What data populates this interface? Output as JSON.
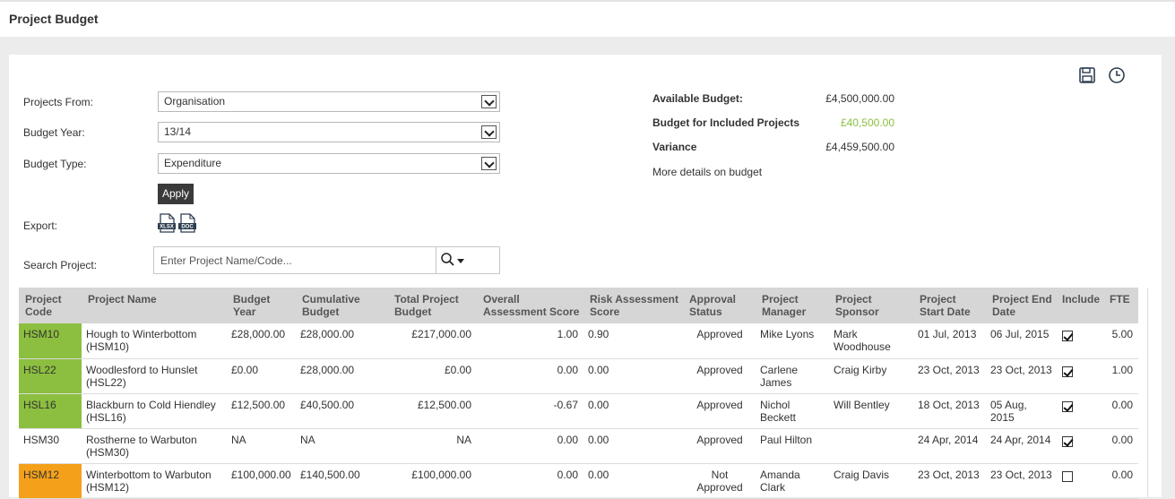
{
  "page": {
    "title": "Project Budget"
  },
  "filters": {
    "projects_from": {
      "label": "Projects From:",
      "value": "Organisation"
    },
    "budget_year": {
      "label": "Budget Year:",
      "value": "13/14"
    },
    "budget_type": {
      "label": "Budget Type:",
      "value": "Expenditure"
    },
    "apply_label": "Apply",
    "export_label": "Export:",
    "export_xlsx": "XLSX",
    "export_doc": "DOC",
    "search_label": "Search Project:",
    "search_placeholder": "Enter Project Name/Code..."
  },
  "budget_summary": {
    "available_label": "Available Budget:",
    "available_value": "£4,500,000.00",
    "included_label": "Budget for Included Projects",
    "included_value": "£40,500.00",
    "variance_label": "Variance",
    "variance_value": "£4,459,500.00",
    "more_link": "More details on budget"
  },
  "colors": {
    "green": "#8cbf3f",
    "orange": "#f5a01a",
    "header_bg": "#d6d6d6"
  },
  "table": {
    "columns": [
      "Project Code",
      "Project Name",
      "Budget Year",
      "Cumulative Budget",
      "Total Project Budget",
      "Overall Assessment Score",
      "Risk Assessment Score",
      "Approval Status",
      "Project Manager",
      "Project Sponsor",
      "Project Start Date",
      "Project End Date",
      "Include",
      "FTE"
    ],
    "rows": [
      {
        "code": "HSM10",
        "status_color": "green",
        "name": "Hough to Winterbottom (HSM10)",
        "budget_year": "£28,000.00",
        "cumulative": "£28,000.00",
        "total": "£217,000.00",
        "overall": "1.00",
        "risk": "0.90",
        "approval": "Approved",
        "manager": "Mike Lyons",
        "sponsor": "Mark Woodhouse",
        "start": "01 Jul, 2013",
        "end": "06 Jul, 2015",
        "include": true,
        "fte": "5.00"
      },
      {
        "code": "HSL22",
        "status_color": "green",
        "name": "Woodlesford to Hunslet (HSL22)",
        "budget_year": "£0.00",
        "cumulative": "£28,000.00",
        "total": "£0.00",
        "overall": "0.00",
        "risk": "0.00",
        "approval": "Approved",
        "manager": "Carlene James",
        "sponsor": "Craig Kirby",
        "start": "23 Oct, 2013",
        "end": "23 Oct, 2013",
        "include": true,
        "fte": "1.00"
      },
      {
        "code": "HSL16",
        "status_color": "green",
        "name": "Blackburn to Cold Hiendley (HSL16)",
        "budget_year": "£12,500.00",
        "cumulative": "£40,500.00",
        "total": "£12,500.00",
        "overall": "-0.67",
        "risk": "0.00",
        "approval": "Approved",
        "manager": "Nichol Beckett",
        "sponsor": "Will Bentley",
        "start": "18 Oct, 2013",
        "end": "05 Aug, 2015",
        "include": true,
        "fte": "0.00"
      },
      {
        "code": "HSM30",
        "status_color": "none",
        "name": "Rostherne to Warbuton (HSM30)",
        "budget_year": "NA",
        "cumulative": "NA",
        "total": "NA",
        "overall": "0.00",
        "risk": "0.00",
        "approval": "Approved",
        "manager": "Paul Hilton",
        "sponsor": "",
        "start": "24 Apr, 2014",
        "end": "24 Apr, 2014",
        "include": true,
        "fte": "0.00"
      },
      {
        "code": "HSM12",
        "status_color": "orange",
        "name": "Winterbottom to Warbuton (HSM12)",
        "budget_year": "£100,000.00",
        "cumulative": "£140,500.00",
        "total": "£100,000.00",
        "overall": "0.00",
        "risk": "0.00",
        "approval": "Not Approved",
        "manager": "Amanda Clark",
        "sponsor": "Craig Davis",
        "start": "23 Oct, 2013",
        "end": "23 Oct, 2013",
        "include": false,
        "fte": "0.00"
      }
    ]
  }
}
